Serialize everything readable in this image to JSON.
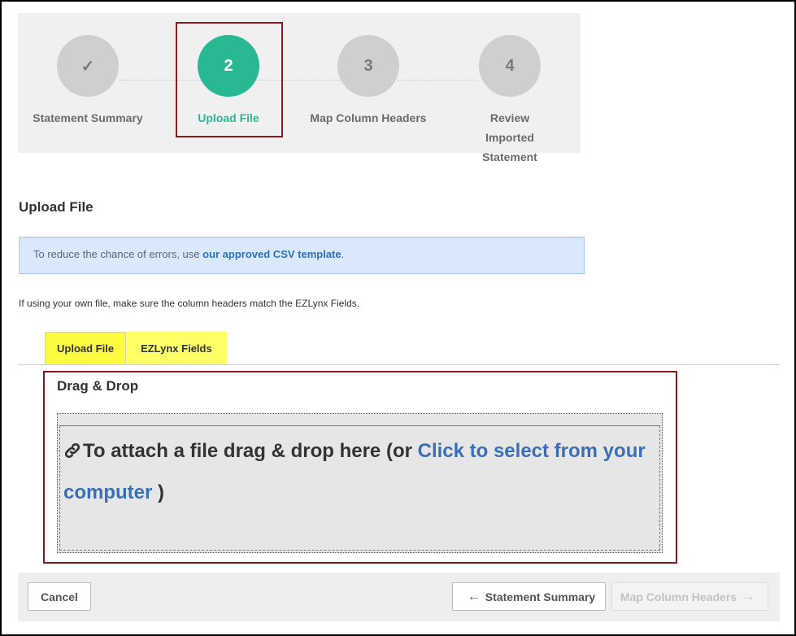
{
  "stepper": {
    "steps": [
      {
        "number": "✓",
        "label": "Statement Summary",
        "state": "done"
      },
      {
        "number": "2",
        "label": "Upload File",
        "state": "active"
      },
      {
        "number": "3",
        "label": "Map Column Headers",
        "state": "pending"
      },
      {
        "number": "4",
        "label": "Review Imported Statement",
        "state": "pending"
      }
    ]
  },
  "section_title": "Upload File",
  "alert": {
    "text": "To reduce the chance of errors, use ",
    "link": "our approved CSV template",
    "suffix": "."
  },
  "note": "If using your own file, make sure the column headers match the EZLynx Fields.",
  "tabs": [
    {
      "label": "Upload File"
    },
    {
      "label": "EZLynx Fields"
    }
  ],
  "dropzone": {
    "title": "Drag & Drop",
    "text": "To attach a file drag & drop here (or ",
    "link": "Click to select from your computer",
    "suffix": " )",
    "icon": "link-icon"
  },
  "footer": {
    "cancel": "Cancel",
    "back": "Statement Summary",
    "next": "Map Column Headers"
  },
  "colors": {
    "accent": "#2ab894",
    "highlight_outline": "#8b1a1a",
    "tab_highlight": "#ffff66",
    "link": "#3a6fb7"
  }
}
